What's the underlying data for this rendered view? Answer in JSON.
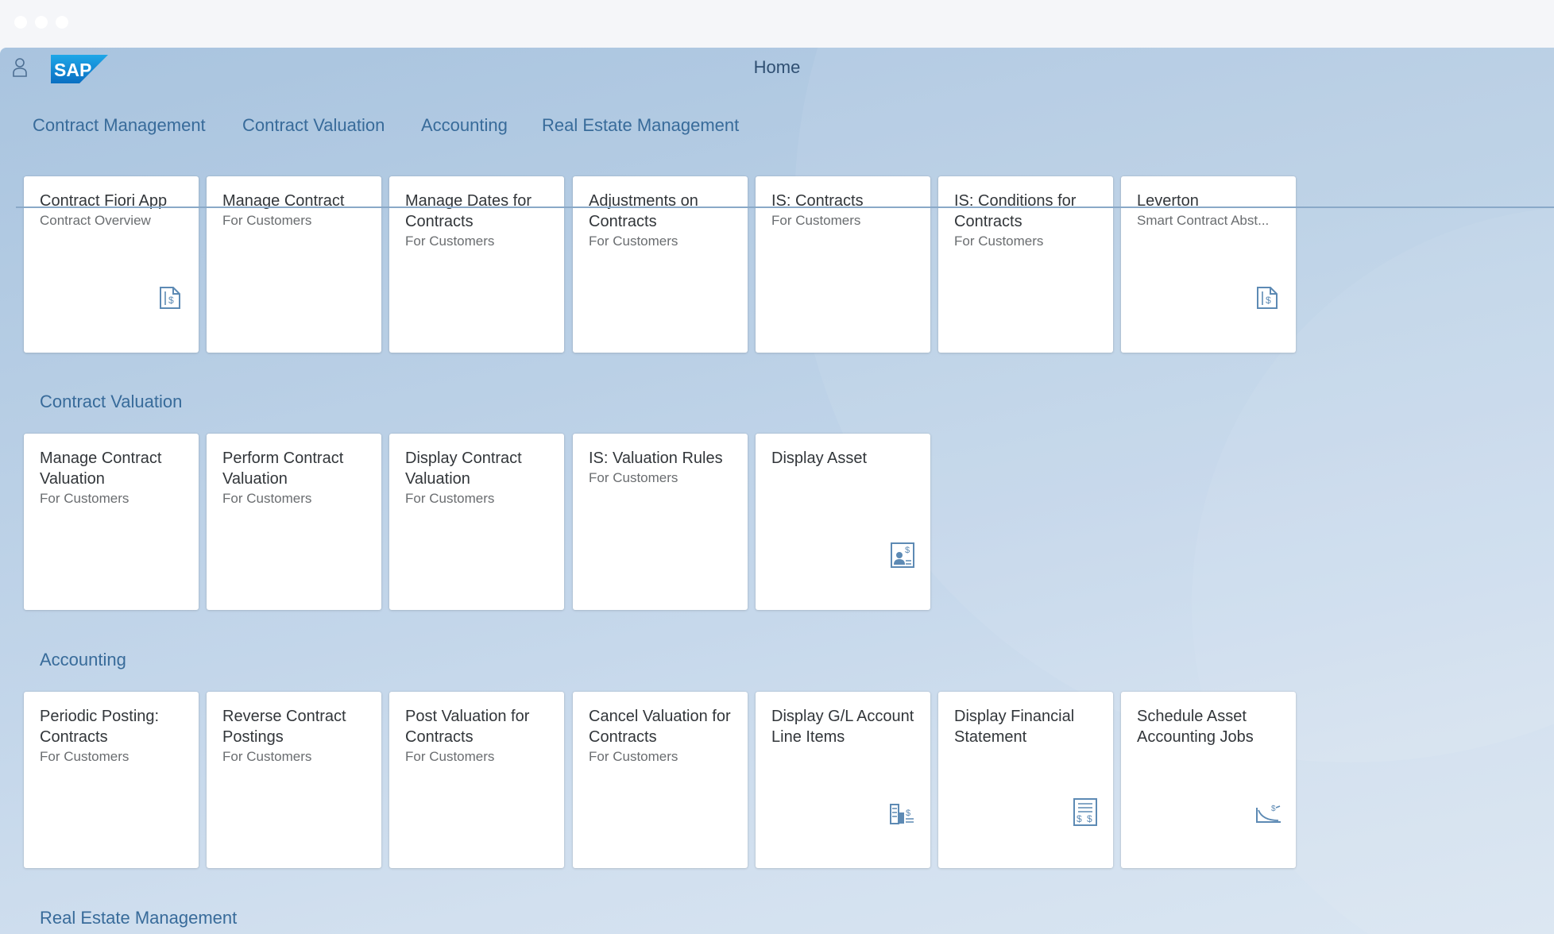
{
  "shell": {
    "title": "Home",
    "logo_text": "SAP",
    "user_icon": "person-icon"
  },
  "tabs": [
    {
      "label": "Contract Management"
    },
    {
      "label": "Contract Valuation"
    },
    {
      "label": "Accounting"
    },
    {
      "label": "Real Estate Management"
    }
  ],
  "sections": {
    "contract_management": {
      "tiles": [
        {
          "title": "Contract Fiori App",
          "subtitle": "Contract Overview",
          "icon": "contract-document-icon"
        },
        {
          "title": "Manage Contract",
          "subtitle": "For Customers"
        },
        {
          "title": "Manage Dates for Contracts",
          "subtitle": "For Customers"
        },
        {
          "title": "Adjustments on Contracts",
          "subtitle": "For Customers"
        },
        {
          "title": "IS: Contracts",
          "subtitle": "For Customers"
        },
        {
          "title": "IS: Conditions for Contracts",
          "subtitle": "For Customers"
        },
        {
          "title": "Leverton",
          "subtitle": "Smart Contract Abst...",
          "icon": "contract-document-icon"
        }
      ]
    },
    "contract_valuation": {
      "title": "Contract Valuation",
      "tiles": [
        {
          "title": "Manage Contract Valuation",
          "subtitle": "For Customers"
        },
        {
          "title": "Perform Contract Valuation",
          "subtitle": "For Customers"
        },
        {
          "title": "Display Contract Valuation",
          "subtitle": "For Customers"
        },
        {
          "title": "IS: Valuation Rules",
          "subtitle": "For Customers"
        },
        {
          "title": "Display Asset",
          "subtitle": "",
          "icon": "asset-card-icon"
        }
      ]
    },
    "accounting": {
      "title": "Accounting",
      "tiles": [
        {
          "title": "Periodic Posting: Contracts",
          "subtitle": "For Customers"
        },
        {
          "title": "Reverse Contract Postings",
          "subtitle": "For Customers"
        },
        {
          "title": "Post Valuation for Contracts",
          "subtitle": "For Customers"
        },
        {
          "title": "Cancel Valuation for Contracts",
          "subtitle": "For Customers"
        },
        {
          "title": "Display G/L Account Line Items",
          "subtitle": "",
          "icon": "ledger-icon"
        },
        {
          "title": "Display Financial Statement",
          "subtitle": "",
          "icon": "financial-statement-icon"
        },
        {
          "title": "Schedule Asset Accounting Jobs",
          "subtitle": "",
          "icon": "depreciation-chart-icon"
        }
      ]
    },
    "real_estate": {
      "title": "Real Estate Management"
    }
  },
  "colors": {
    "accent": "#386b9a",
    "tile_background": "#ffffff",
    "icon": "#5d8ab4"
  }
}
